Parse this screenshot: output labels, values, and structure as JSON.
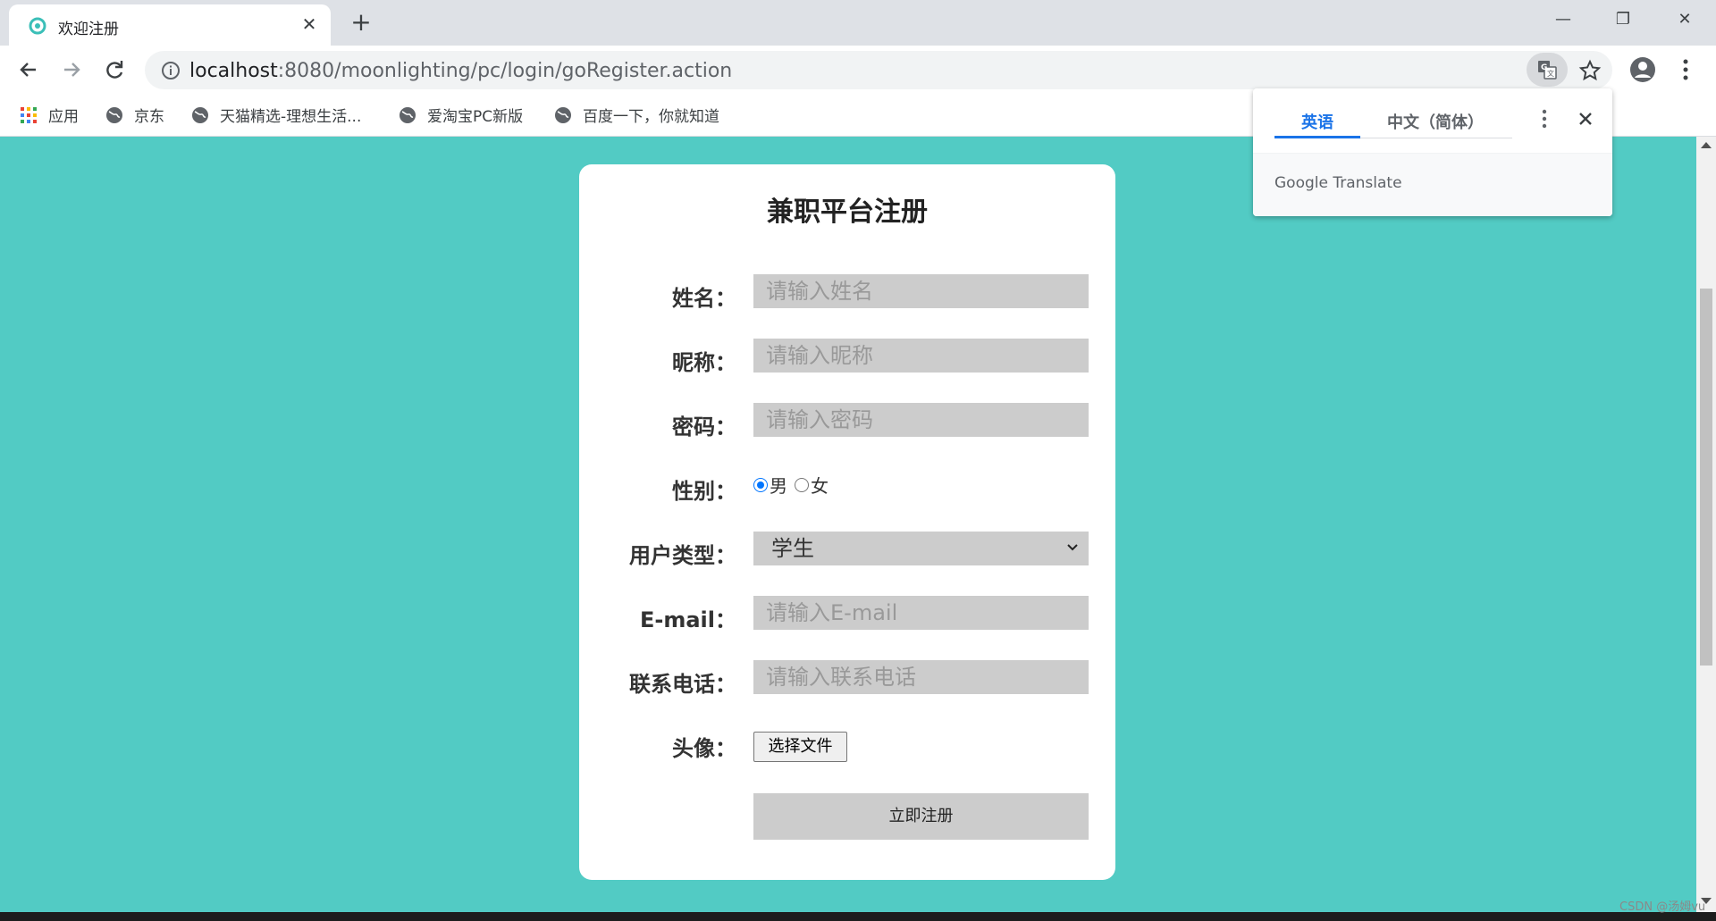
{
  "browser": {
    "tab_title": "欢迎注册",
    "tab_close": "✕",
    "new_tab": "+",
    "url_host": "localhost",
    "url_path": ":8080/moonlighting/pc/login/goRegister.action"
  },
  "window_controls": {
    "minimize": "—",
    "restore": "❐",
    "close": "✕"
  },
  "bookmarks": [
    {
      "label": "应用",
      "icon": "apps-grid-icon"
    },
    {
      "label": "京东",
      "icon": "globe-icon"
    },
    {
      "label": "天猫精选-理想生活...",
      "icon": "globe-icon"
    },
    {
      "label": "爱淘宝PC新版",
      "icon": "globe-icon"
    },
    {
      "label": "百度一下，你就知道",
      "icon": "globe-icon"
    }
  ],
  "translate_popup": {
    "tab_active": "英语",
    "tab_inactive": "中文（简体）",
    "brand": "Google Translate"
  },
  "form": {
    "title": "兼职平台注册",
    "name_label": "姓名：",
    "name_placeholder": "请输入姓名",
    "nickname_label": "昵称：",
    "nickname_placeholder": "请输入昵称",
    "password_label": "密码：",
    "password_placeholder": "请输入密码",
    "gender_label": "性别：",
    "gender_male": "男",
    "gender_female": "女",
    "gender_selected": "男",
    "usertype_label": "用户类型：",
    "usertype_value": "学生",
    "email_label": "E-mail：",
    "email_placeholder": "请输入E-mail",
    "phone_label": "联系电话：",
    "phone_placeholder": "请输入联系电话",
    "avatar_label": "头像：",
    "file_button": "选择文件",
    "submit_button": "立即注册"
  },
  "colors": {
    "page_background": "#52cbc4",
    "field_background": "#cccccc",
    "accent_blue": "#1a73e8"
  },
  "watermark": "CSDN @汤姆vu"
}
